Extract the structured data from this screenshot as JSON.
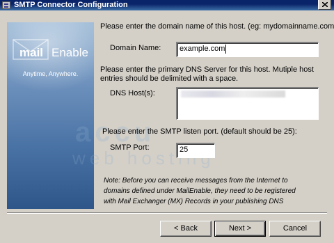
{
  "window": {
    "title": "SMTP Connector Configuration",
    "close_glyph": "×"
  },
  "branding": {
    "logo_mail": "mail",
    "logo_enable": "Enable",
    "tagline": "Anytime, Anywhere."
  },
  "watermark": {
    "line1": "accu",
    "line2": "web hosting"
  },
  "domain": {
    "prompt": "Please enter the domain name of this host. (eg: mydomainname.com).",
    "label": "Domain Name:",
    "value": "example.com"
  },
  "dns": {
    "prompt_line1": "Please enter the primary DNS Server for this host. Mutiple host",
    "prompt_line2": "entries should be delimited with a space.",
    "label": "DNS Host(s):"
  },
  "smtp": {
    "prompt": "Please enter the SMTP listen port. (default should be 25):",
    "label": "SMTP Port:",
    "value": "25"
  },
  "note": {
    "line1": "Note: Before you can receive messages from the Internet to",
    "line2": "domains defined under MailEnable, they need to be registered",
    "line3": "with Mail Exchanger (MX) Records in your publishing DNS"
  },
  "buttons": {
    "back_label": "< Back",
    "next_label": "Next >",
    "cancel_label": "Cancel"
  },
  "colors": {
    "titlebar": "#0a246a",
    "dialog_bg": "#d4d0c8",
    "brand_panel": "#4b74a6"
  }
}
